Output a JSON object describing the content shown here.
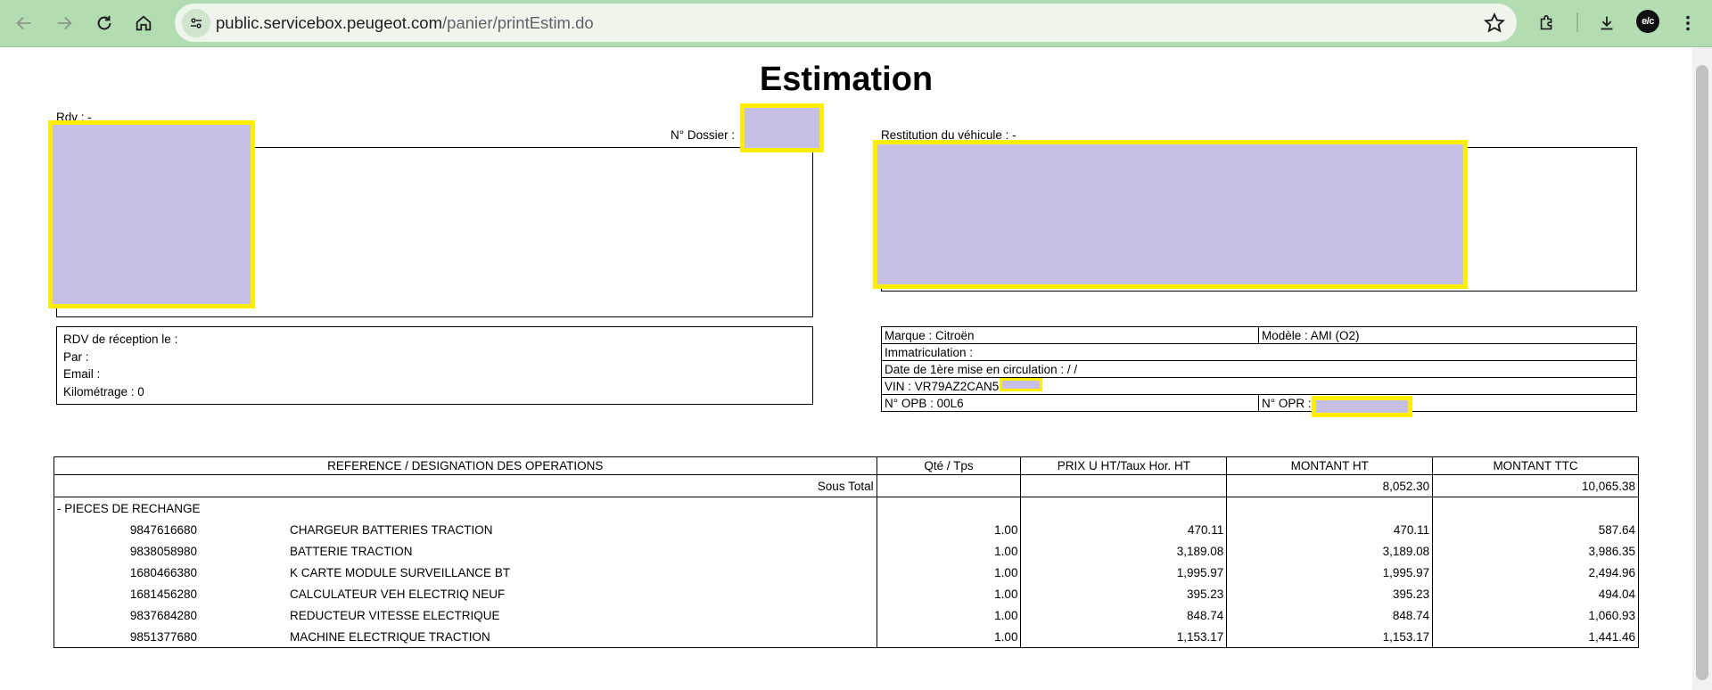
{
  "browser": {
    "url_host": "public.servicebox.peugeot.com",
    "url_path": "/panier/printEstim.do",
    "avatar_text": "e/c",
    "icons": [
      "back-arrow-icon",
      "forward-arrow-icon",
      "reload-icon",
      "home-icon",
      "site-info-icon",
      "bookmark-star-icon",
      "extensions-icon",
      "download-icon",
      "menu-icon"
    ]
  },
  "doc": {
    "title": "Estimation",
    "rdv_label": "Rdv : -",
    "dossier_label": "N° Dossier :",
    "restitution_label": "Restitution du véhicule : -",
    "reception": {
      "rdv_reception": "RDV de réception le :",
      "par": "Par :",
      "email": "Email :",
      "kilometrage": "Kilométrage : 0"
    },
    "vehicle": {
      "marque": "Marque : Citroën",
      "modele": "Modèle : AMI (O2)",
      "immatriculation": "Immatriculation :",
      "date_circulation": "Date de 1ère mise en circulation : / /",
      "vin": "VIN : VR79AZ2CAN5",
      "opb": "N° OPB : 00L6",
      "opr": "N° OPR :"
    },
    "table": {
      "headers": [
        "REFERENCE / DESIGNATION DES OPERATIONS",
        "Qté / Tps",
        "PRIX U HT/Taux Hor. HT",
        "MONTANT HT",
        "MONTANT TTC"
      ],
      "subtotal": {
        "label": "Sous Total",
        "ht": "8,052.30",
        "ttc": "10,065.38"
      },
      "section": "- PIECES DE RECHANGE",
      "rows": [
        {
          "ref": "9847616680",
          "designation": "CHARGEUR BATTERIES TRACTION",
          "qty": "1.00",
          "prix": "470.11",
          "ht": "470.11",
          "ttc": "587.64"
        },
        {
          "ref": "9838058980",
          "designation": "BATTERIE TRACTION",
          "qty": "1.00",
          "prix": "3,189.08",
          "ht": "3,189.08",
          "ttc": "3,986.35"
        },
        {
          "ref": "1680466380",
          "designation": "K CARTE MODULE SURVEILLANCE BT",
          "qty": "1.00",
          "prix": "1,995.97",
          "ht": "1,995.97",
          "ttc": "2,494.96"
        },
        {
          "ref": "1681456280",
          "designation": "CALCULATEUR VEH ELECTRIQ NEUF",
          "qty": "1.00",
          "prix": "395.23",
          "ht": "395.23",
          "ttc": "494.04"
        },
        {
          "ref": "9837684280",
          "designation": "REDUCTEUR VITESSE ELECTRIQUE",
          "qty": "1.00",
          "prix": "848.74",
          "ht": "848.74",
          "ttc": "1,060.93"
        },
        {
          "ref": "9851377680",
          "designation": "MACHINE ELECTRIQUE TRACTION",
          "qty": "1.00",
          "prix": "1,153.17",
          "ht": "1,153.17",
          "ttc": "1,441.46"
        }
      ]
    }
  }
}
